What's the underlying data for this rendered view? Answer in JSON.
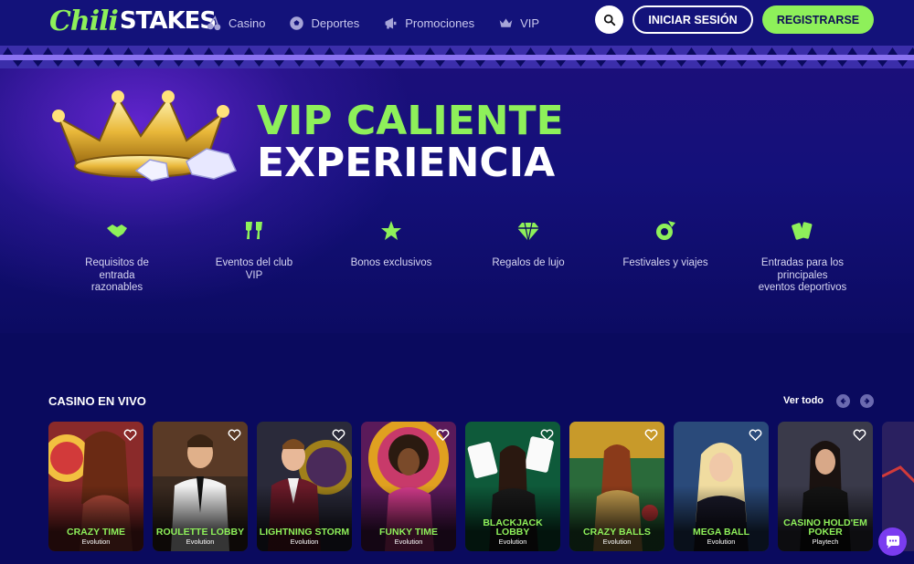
{
  "header": {
    "logo": {
      "part1": "Chili",
      "part2": "STAKES"
    },
    "nav": [
      {
        "label": "Casino",
        "icon": "cherry-icon"
      },
      {
        "label": "Deportes",
        "icon": "soccer-ball-icon"
      },
      {
        "label": "Promociones",
        "icon": "megaphone-icon"
      },
      {
        "label": "VIP",
        "icon": "crown-icon"
      }
    ],
    "login_label": "INICIAR SESIÓN",
    "register_label": "REGISTRARSE"
  },
  "hero": {
    "title_line1": "VIP CALIENTE",
    "title_line2": "EXPERIENCIA",
    "features": [
      {
        "label": "Requisitos de entrada razonables",
        "icon": "handshake-icon"
      },
      {
        "label": "Eventos del club VIP",
        "icon": "champagne-glasses-icon"
      },
      {
        "label": "Bonos exclusivos",
        "icon": "star-icon"
      },
      {
        "label": "Regalos de lujo",
        "icon": "diamond-icon"
      },
      {
        "label": "Festivales y viajes",
        "icon": "festival-icon"
      },
      {
        "label": "Entradas para los principales eventos deportivos",
        "icon": "tickets-icon"
      }
    ]
  },
  "live_casino": {
    "title": "CASINO EN VIVO",
    "see_all": "Ver todo",
    "games": [
      {
        "name": "CRAZY TIME",
        "provider": "Evolution"
      },
      {
        "name": "ROULETTE LOBBY",
        "provider": "Evolution"
      },
      {
        "name": "LIGHTNING STORM",
        "provider": "Evolution"
      },
      {
        "name": "FUNKY TIME",
        "provider": "Evolution"
      },
      {
        "name": "BLACKJACK LOBBY",
        "provider": "Evolution"
      },
      {
        "name": "CRAZY BALLS",
        "provider": "Evolution"
      },
      {
        "name": "MEGA BALL",
        "provider": "Evolution"
      },
      {
        "name": "CASINO HOLD'EM POKER",
        "provider": "Playtech"
      }
    ]
  },
  "colors": {
    "accent_green": "#8ef05a",
    "navy": "#0a0a5e",
    "header": "#13127a",
    "chat_purple": "#7a3cf0"
  }
}
